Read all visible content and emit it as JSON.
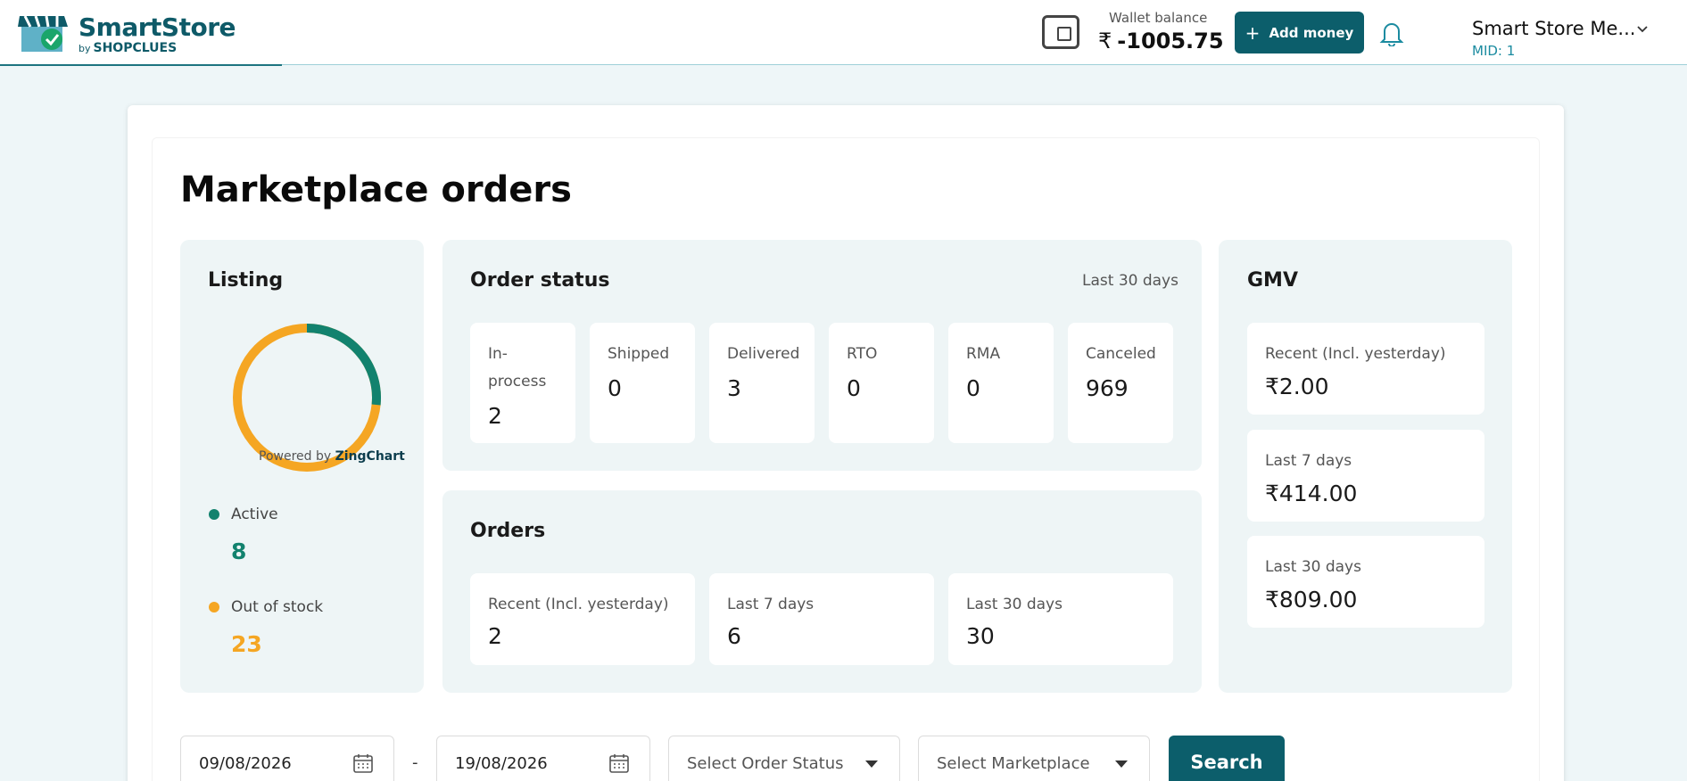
{
  "brand": {
    "name": "SmartStore",
    "by": "by",
    "sub": "SHOPCLUES"
  },
  "header": {
    "wallet_label": "Wallet balance",
    "currency_symbol": "₹",
    "wallet_value": "-1005.75",
    "add_money_label": "Add money",
    "merchant_name": "Smart Store Me...",
    "mid": "MID: 1"
  },
  "page": {
    "title": "Marketplace orders"
  },
  "listing": {
    "title": "Listing",
    "powered_by": "Powered by",
    "powered_brand": "ZingChart",
    "active_label": "Active",
    "active_value": "8",
    "out_of_stock_label": "Out of stock",
    "out_of_stock_value": "23",
    "colors": {
      "active": "#12826e",
      "out_of_stock": "#f5a623"
    }
  },
  "order_status": {
    "title": "Order status",
    "period": "Last 30 days",
    "tiles": [
      {
        "label": "In-process",
        "value": "2"
      },
      {
        "label": "Shipped",
        "value": "0"
      },
      {
        "label": "Delivered",
        "value": "3"
      },
      {
        "label": "RTO",
        "value": "0"
      },
      {
        "label": "RMA",
        "value": "0"
      },
      {
        "label": "Canceled",
        "value": "969"
      }
    ]
  },
  "orders": {
    "title": "Orders",
    "tiles": [
      {
        "label": "Recent (Incl. yesterday)",
        "value": "2"
      },
      {
        "label": "Last 7 days",
        "value": "6"
      },
      {
        "label": "Last 30 days",
        "value": "30"
      }
    ]
  },
  "gmv": {
    "title": "GMV",
    "tiles": [
      {
        "label": "Recent (Incl. yesterday)",
        "value": "₹2.00"
      },
      {
        "label": "Last 7 days",
        "value": "₹414.00"
      },
      {
        "label": "Last 30 days",
        "value": "₹809.00"
      }
    ]
  },
  "filters": {
    "from_date": "09/08/2026",
    "separator": "-",
    "to_date": "19/08/2026",
    "order_status_placeholder": "Select Order Status",
    "marketplace_placeholder": "Select Marketplace",
    "search_label": "Search"
  },
  "icons": {
    "wallet": "wallet-icon",
    "bell": "bell-icon",
    "calendar": "calendar-icon",
    "caret": "chevron-down-icon"
  },
  "colors": {
    "primary": "#0c5e6b",
    "bg": "#eef6f8",
    "panel": "#eef5f6"
  }
}
